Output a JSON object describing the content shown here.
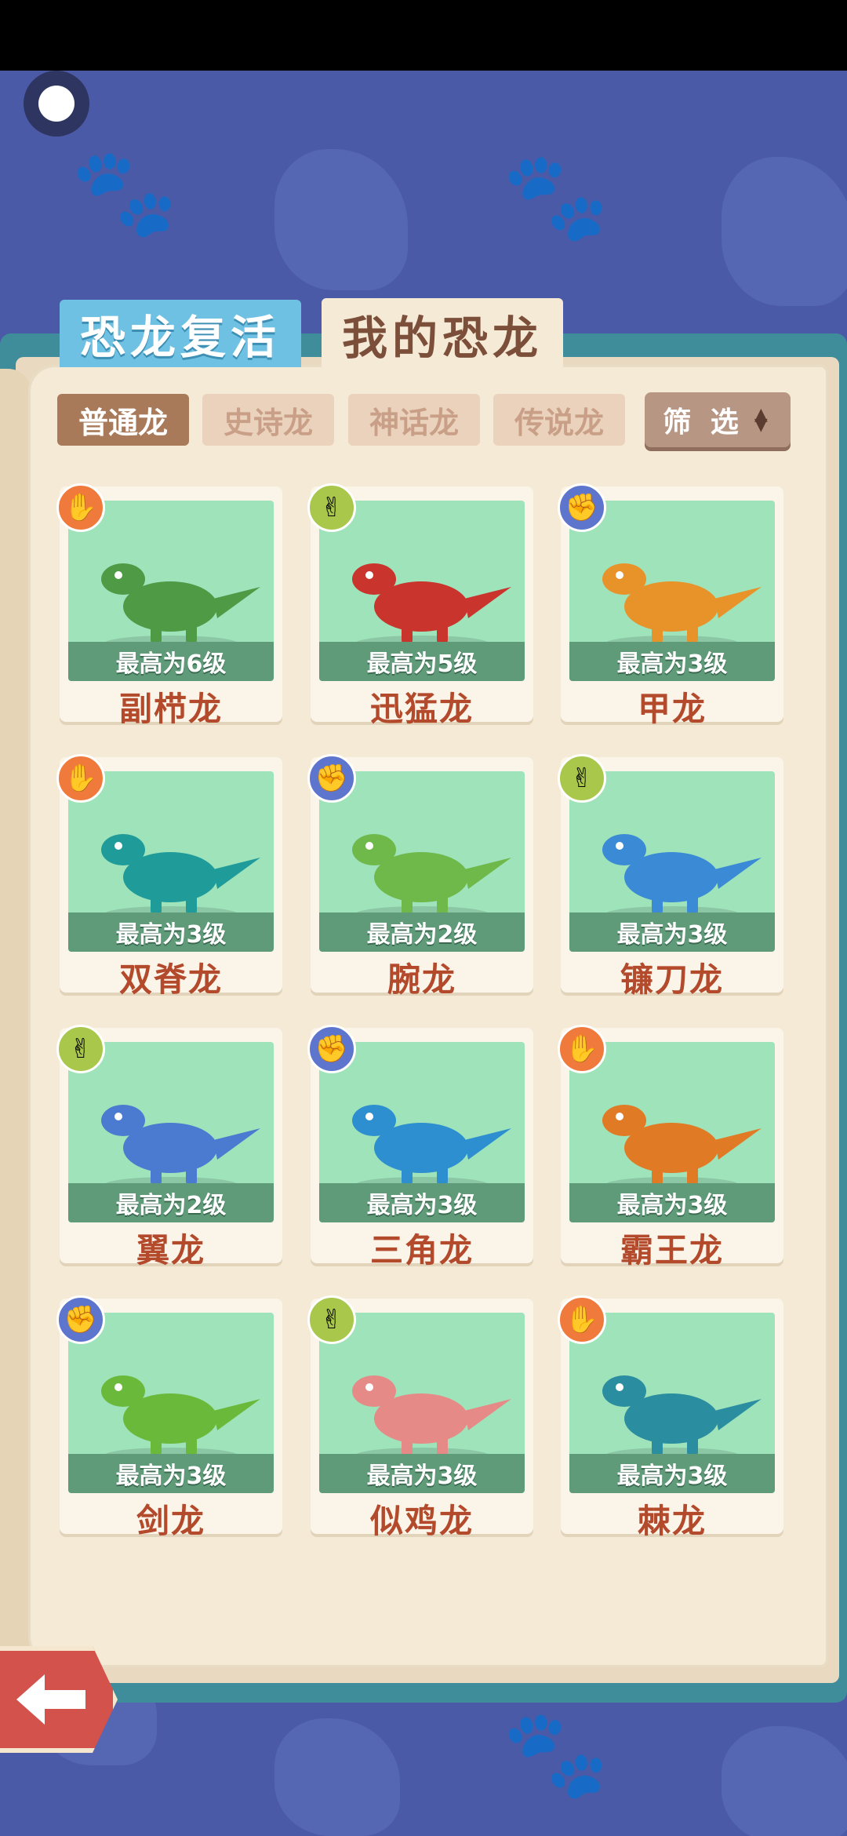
{
  "tabs": {
    "revive": "恐龙复活",
    "mine": "我的恐龙"
  },
  "rarity_filters": [
    "普通龙",
    "史诗龙",
    "神话龙",
    "传说龙"
  ],
  "filter_button": "筛 选",
  "colors": {
    "background": "#4b5aa6",
    "board": "#3f8d9a",
    "page": "#f5ead6",
    "active_rarity": "#a87a5a",
    "card_portrait": "#9fe3bb",
    "level_bar": "#5f9a79",
    "name_text": "#b34a2c",
    "badge_paper": "#f07a3c",
    "badge_scissors": "#a9c74a",
    "badge_rock": "#5d75cc"
  },
  "dinosaurs": [
    {
      "name": "副栉龙",
      "level": "最高为6级",
      "badge": "paper-hand-icon",
      "dino_color": "#4e9a45"
    },
    {
      "name": "迅猛龙",
      "level": "最高为5级",
      "badge": "scissors-hand-icon",
      "dino_color": "#c9342c"
    },
    {
      "name": "甲龙",
      "level": "最高为3级",
      "badge": "rock-hand-icon",
      "dino_color": "#e8922a"
    },
    {
      "name": "双脊龙",
      "level": "最高为3级",
      "badge": "paper-hand-icon",
      "dino_color": "#1f9b9a"
    },
    {
      "name": "腕龙",
      "level": "最高为2级",
      "badge": "rock-hand-icon",
      "dino_color": "#6fb84a"
    },
    {
      "name": "镰刀龙",
      "level": "最高为3级",
      "badge": "scissors-hand-icon",
      "dino_color": "#3b8ad6"
    },
    {
      "name": "翼龙",
      "level": "最高为2级",
      "badge": "scissors-hand-icon",
      "dino_color": "#4a7bd1"
    },
    {
      "name": "三角龙",
      "level": "最高为3级",
      "badge": "rock-hand-icon",
      "dino_color": "#2d8fcf"
    },
    {
      "name": "霸王龙",
      "level": "最高为3级",
      "badge": "paper-hand-icon",
      "dino_color": "#e07a24"
    },
    {
      "name": "剑龙",
      "level": "最高为3级",
      "badge": "rock-hand-icon",
      "dino_color": "#6bb93a"
    },
    {
      "name": "似鸡龙",
      "level": "最高为3级",
      "badge": "scissors-hand-icon",
      "dino_color": "#e58a86"
    },
    {
      "name": "棘龙",
      "level": "最高为3级",
      "badge": "paper-hand-icon",
      "dino_color": "#2a8da0"
    }
  ]
}
